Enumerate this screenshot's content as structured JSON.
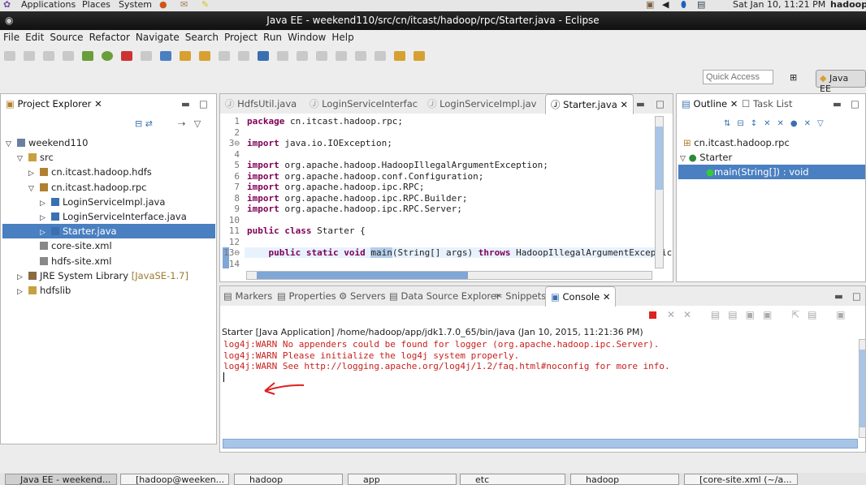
{
  "top_panel": {
    "menus": [
      "Applications",
      "Places",
      "System"
    ],
    "clock": "Sat Jan 10, 11:21 PM",
    "user": "hadoop"
  },
  "window": {
    "title": "Java EE - weekend110/src/cn/itcast/hadoop/rpc/Starter.java - Eclipse"
  },
  "menu": [
    "File",
    "Edit",
    "Source",
    "Refactor",
    "Navigate",
    "Search",
    "Project",
    "Run",
    "Window",
    "Help"
  ],
  "toolbar": {
    "quick_access_placeholder": "Quick Access",
    "perspective": "Java EE"
  },
  "project_explorer": {
    "title": "Project Explorer",
    "tree": [
      {
        "label": "weekend110",
        "depth": 0,
        "expanded": true,
        "icon": "project-icon"
      },
      {
        "label": "src",
        "depth": 1,
        "expanded": true,
        "icon": "source-folder-icon"
      },
      {
        "label": "cn.itcast.hadoop.hdfs",
        "depth": 2,
        "expanded": false,
        "icon": "package-icon"
      },
      {
        "label": "cn.itcast.hadoop.rpc",
        "depth": 2,
        "expanded": true,
        "icon": "package-icon"
      },
      {
        "label": "LoginServiceImpl.java",
        "depth": 3,
        "expanded": false,
        "icon": "java-file-icon"
      },
      {
        "label": "LoginServiceInterface.java",
        "depth": 3,
        "expanded": false,
        "icon": "java-file-icon"
      },
      {
        "label": "Starter.java",
        "depth": 3,
        "expanded": false,
        "icon": "java-file-icon",
        "selected": true
      },
      {
        "label": "core-site.xml",
        "depth": 2,
        "icon": "xml-file-icon"
      },
      {
        "label": "hdfs-site.xml",
        "depth": 2,
        "icon": "xml-file-icon"
      },
      {
        "label": "JRE System Library",
        "suffix": "[JavaSE-1.7]",
        "depth": 1,
        "expanded": false,
        "icon": "library-icon"
      },
      {
        "label": "hdfslib",
        "depth": 1,
        "expanded": false,
        "icon": "folder-icon"
      }
    ]
  },
  "editor": {
    "tabs": [
      "HdfsUtil.java",
      "LoginServiceInterfac",
      "LoginServiceImpl.jav",
      "Starter.java"
    ],
    "active_tab": 3,
    "lines": [
      {
        "n": "1",
        "kw": "package",
        "rest": " cn.itcast.hadoop.rpc;"
      },
      {
        "n": "2",
        "kw": "",
        "rest": ""
      },
      {
        "n": "3⊖",
        "kw": "import",
        "rest": " java.io.IOException;"
      },
      {
        "n": "4",
        "kw": "",
        "rest": ""
      },
      {
        "n": "5",
        "kw": "import",
        "rest": " org.apache.hadoop.HadoopIllegalArgumentException;"
      },
      {
        "n": "6",
        "kw": "import",
        "rest": " org.apache.hadoop.conf.Configuration;"
      },
      {
        "n": "7",
        "kw": "import",
        "rest": " org.apache.hadoop.ipc.RPC;"
      },
      {
        "n": "8",
        "kw": "import",
        "rest": " org.apache.hadoop.ipc.RPC.Builder;"
      },
      {
        "n": "9",
        "kw": "import",
        "rest": " org.apache.hadoop.ipc.RPC.Server;"
      },
      {
        "n": "10",
        "kw": "",
        "rest": ""
      },
      {
        "n": "11",
        "kw": "public class",
        "rest": " Starter {"
      },
      {
        "n": "12",
        "kw": "",
        "rest": ""
      },
      {
        "n": "13⊖",
        "kw": "    public static void",
        "rest": " main(String[] args) throws HadoopIllegalArgumentExceptic"
      },
      {
        "n": "14",
        "kw": "",
        "rest": ""
      }
    ]
  },
  "outline": {
    "tabs": [
      "Outline",
      "Task List"
    ],
    "items": [
      {
        "label": "cn.itcast.hadoop.rpc",
        "icon": "package-icon"
      },
      {
        "label": "Starter",
        "icon": "class-icon"
      },
      {
        "label": "main(String[]) : void",
        "icon": "method-icon",
        "selected": true
      }
    ]
  },
  "bottom": {
    "tabs": [
      "Markers",
      "Properties",
      "Servers",
      "Data Source Explorer",
      "Snippets",
      "Console"
    ],
    "active_tab": 5,
    "console_header": "Starter [Java Application] /home/hadoop/app/jdk1.7.0_65/bin/java (Jan 10, 2015, 11:21:36 PM)",
    "console_lines": [
      "log4j:WARN No appenders could be found for logger (org.apache.hadoop.ipc.Server).",
      "log4j:WARN Please initialize the log4j system properly.",
      "log4j:WARN See http://logging.apache.org/log4j/1.2/faq.html#noconfig for more info."
    ]
  },
  "taskbar": [
    "Java EE - weekend...",
    "[hadoop@weeken...",
    "hadoop",
    "app",
    "etc",
    "hadoop",
    "[core-site.xml (~/a..."
  ],
  "colors": {
    "selection": "#4a7fc1",
    "console_error": "#c8201e",
    "keyword": "#7f0055",
    "annotation_arrow": "#e02020"
  }
}
